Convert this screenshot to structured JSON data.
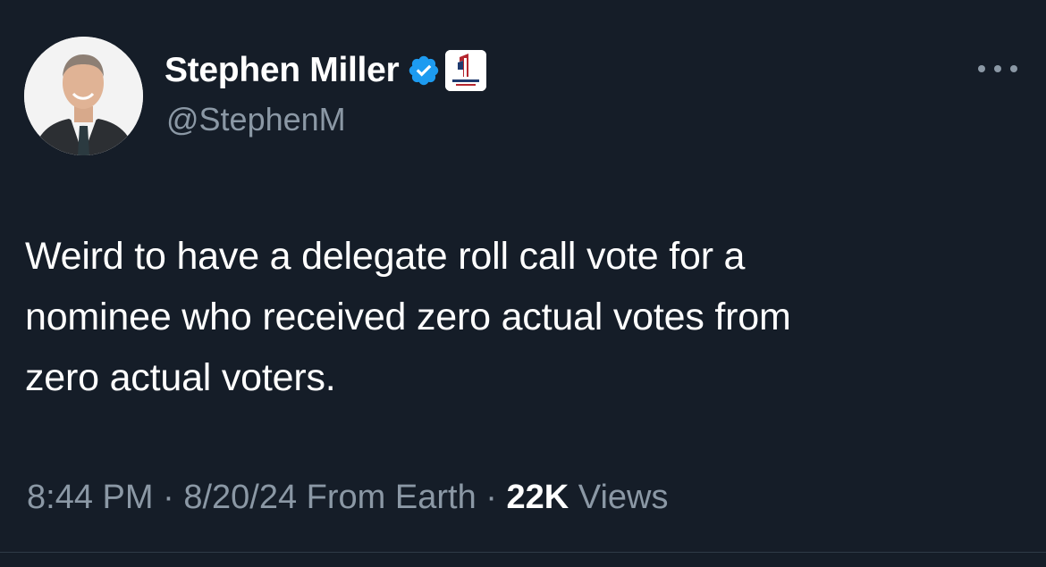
{
  "author": {
    "display_name": "Stephen Miller",
    "handle": "@StephenM",
    "verified_icon": "verified-badge-icon",
    "affiliation_badge": {
      "icon": "america-first-legal-logo",
      "text": "AMERICA FIRST"
    },
    "avatar_icon": "profile-photo"
  },
  "tweet": {
    "text": "Weird to have a delegate roll call vote for a\nnominee who received zero actual votes from\nzero actual voters."
  },
  "meta": {
    "time": "8:44 PM",
    "separator": " · ",
    "date": "8/20/24",
    "source": "From Earth",
    "views_count": "22K",
    "views_label": "Views"
  },
  "colors": {
    "background": "#151d28",
    "secondary_text": "#8b98a5",
    "verified_blue": "#1d9bf0"
  }
}
